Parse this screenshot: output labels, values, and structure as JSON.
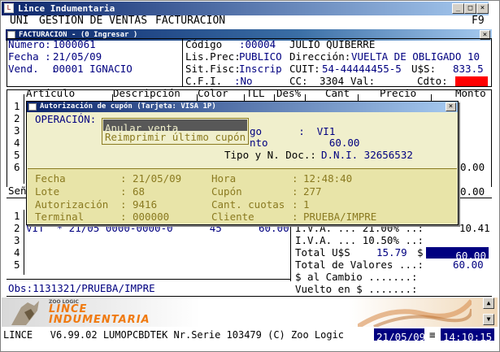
{
  "app": {
    "title": "Lince Indumentaria",
    "menu": [
      "UNI",
      "GESTION DE VENTAS",
      "FACTURACION"
    ],
    "f9": "F9"
  },
  "invoice_window": {
    "title": "FACTURACION - (0  Ingresar )",
    "numero_label": "Número:",
    "numero": "1000061",
    "fecha_label": "Fecha :",
    "fecha": "21/05/09",
    "vend_label": "Vend.  :",
    "vend": "00001 IGNACIO",
    "codigo_label": "Código",
    "codigo": ":00004",
    "cliente_nombre": "JULIO QUIBERRE",
    "lisprec_label": "Lis.Prec:",
    "lisprec": "PUBLICO",
    "direccion_label": "Dirección:",
    "direccion": "VUELTA DE OBLIGADO 10",
    "sitfisc_label": "Sit.Fisc:",
    "sitfisc": "Inscrip",
    "cuit_label": "CUIT:",
    "cuit": "54-44444455-5",
    "uss_label": "U$S:",
    "uss": "833.5",
    "cfi_label": "C.F.I.",
    "cfi": ":No",
    "cc_label": "CC:",
    "cc": "3304",
    "val_label": "Val:",
    "cdto_label": "Cdto:",
    "cdto": "",
    "columns": [
      "Artículo",
      "Descripción",
      "Color",
      "TLL",
      "Des%",
      "Cant",
      "Precio",
      "Monto"
    ],
    "row_numbers": [
      "1",
      "2",
      "3",
      "4",
      "5",
      "6"
    ],
    "senas_label": "Señ",
    "right_value_1": "0.00",
    "right_value_2": "0.00",
    "pay_rows": [
      "1",
      "2",
      "3",
      "4",
      "5"
    ],
    "pay_row_1": "VIT  * 21/05 0000-0000-0      45",
    "pay_row_1_amount": "60.00",
    "totals": {
      "iva1_label": "I.V.A. ... 21.00% ..:",
      "iva1": "10.41",
      "iva2_label": "I.V.A. ... 10.50% ..:",
      "iva2": "",
      "total_label": "Total U$S",
      "total_uss": "15.79",
      "total_sign": "$",
      "total": "60.00",
      "valores_label": "Total de Valores ...:",
      "valores": "60.00",
      "cambio_label": "$ al Cambio .......:",
      "vuelto_label": "Vuelto en $ .......:"
    },
    "obs": "Obs:1131321/PRUEBA/IMPRE"
  },
  "dialog": {
    "title": "Autorización de cupón (Tarjeta: VISA    1P)",
    "operacion_label": "OPERACIÓN:",
    "options": [
      "Anular venta",
      "Reimprimir último cupón"
    ],
    "behind_lines": [
      "go      :  VI1",
      "nto          60.00"
    ],
    "tipo_label": "Tipo y N. Doc.:",
    "tipo_value": "D.N.I. 32656532",
    "details": {
      "fecha_label": "Fecha",
      "fecha": "21/05/09",
      "hora_label": "Hora",
      "hora": "12:48:40",
      "lote_label": "Lote",
      "lote": "68",
      "cupon_label": "Cupón",
      "cupon": "277",
      "autorizacion_label": "Autorización",
      "autorizacion": "9416",
      "cuotas_label": "Cant. cuotas",
      "cuotas": "1",
      "terminal_label": "Terminal",
      "terminal": "000000",
      "cliente_label": "Cliente",
      "cliente": "PRUEBA/IMPRE"
    }
  },
  "brand": {
    "small": "ZOO LOGIC",
    "line1": "LINCE",
    "line2": "INDUMENTARIA"
  },
  "status": {
    "text": "LINCE   V6.99.02 LUMOPCBDTEK Nr.Serie 103479 (C) Zoo Logic",
    "date": "21/05/09",
    "sep": "≡",
    "time": "14:10:15"
  },
  "colors": {
    "navy": "#000080",
    "titlebar": "#0a246a",
    "dialog_bg": "#f0efcc",
    "detail_bg": "#e8e4a8",
    "detail_text": "#8a7a20",
    "highlight_bg": "#000080",
    "cdto_bg": "#ff0000"
  }
}
